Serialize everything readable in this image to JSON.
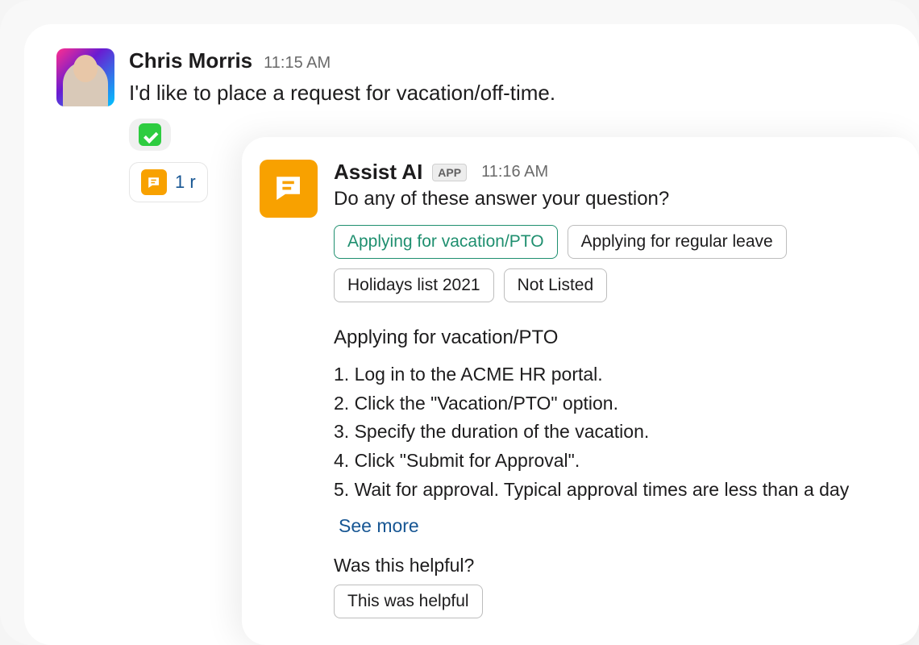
{
  "message": {
    "author": "Chris Morris",
    "time": "11:15 AM",
    "text": "I'd like to place a request for vacation/off-time.",
    "thread_reply_label": "1 r"
  },
  "reply": {
    "author": "Assist AI",
    "app_badge": "APP",
    "time": "11:16 AM",
    "question": "Do any of these answer your question?",
    "options": [
      "Applying for vacation/PTO",
      "Applying for regular leave",
      "Holidays list 2021",
      "Not Listed"
    ],
    "selected_index": 0,
    "answer_title": "Applying for vacation/PTO",
    "answer_steps": [
      "Log in to the ACME HR portal.",
      "Click the \"Vacation/PTO\" option.",
      "Specify the duration of the vacation.",
      "Click \"Submit for Approval\".",
      "Wait for approval. Typical approval times are less than a day"
    ],
    "see_more": "See more",
    "helpful_question": "Was this helpful?",
    "helpful_button": "This was helpful"
  },
  "icons": {
    "check": "check-icon",
    "chat_bubble": "chat-bubble-icon"
  }
}
